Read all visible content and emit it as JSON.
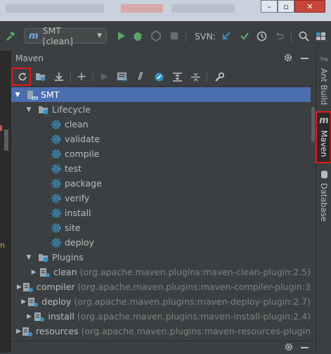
{
  "window": {
    "minimize": "–",
    "maximize": "▫",
    "close": "✕"
  },
  "toolbar": {
    "run_config_label": "SMT [clean]",
    "run_config_icon": "m",
    "svn_label": "SVN:"
  },
  "panel": {
    "title": "Maven"
  },
  "tree": {
    "root": "SMT",
    "lifecycle_label": "Lifecycle",
    "lifecycle": [
      "clean",
      "validate",
      "compile",
      "test",
      "package",
      "verify",
      "install",
      "site",
      "deploy"
    ],
    "plugins_label": "Plugins",
    "plugins": [
      {
        "name": "clean",
        "artifact": "(org.apache.maven.plugins:maven-clean-plugin:2.5)"
      },
      {
        "name": "compiler",
        "artifact": "(org.apache.maven.plugins:maven-compiler-plugin:3"
      },
      {
        "name": "deploy",
        "artifact": "(org.apache.maven.plugins:maven-deploy-plugin:2.7)"
      },
      {
        "name": "install",
        "artifact": "(org.apache.maven.plugins:maven-install-plugin:2.4)"
      },
      {
        "name": "resources",
        "artifact": "(org.apache.maven.plugins:maven-resources-plugin"
      }
    ]
  },
  "side_tabs": {
    "ant": "Ant Build",
    "maven": "Maven",
    "database": "Database"
  },
  "colors": {
    "selection": "#4b6eaf",
    "highlight": "#e01b1b",
    "run": "#59a869",
    "gear": "#3592c4"
  }
}
